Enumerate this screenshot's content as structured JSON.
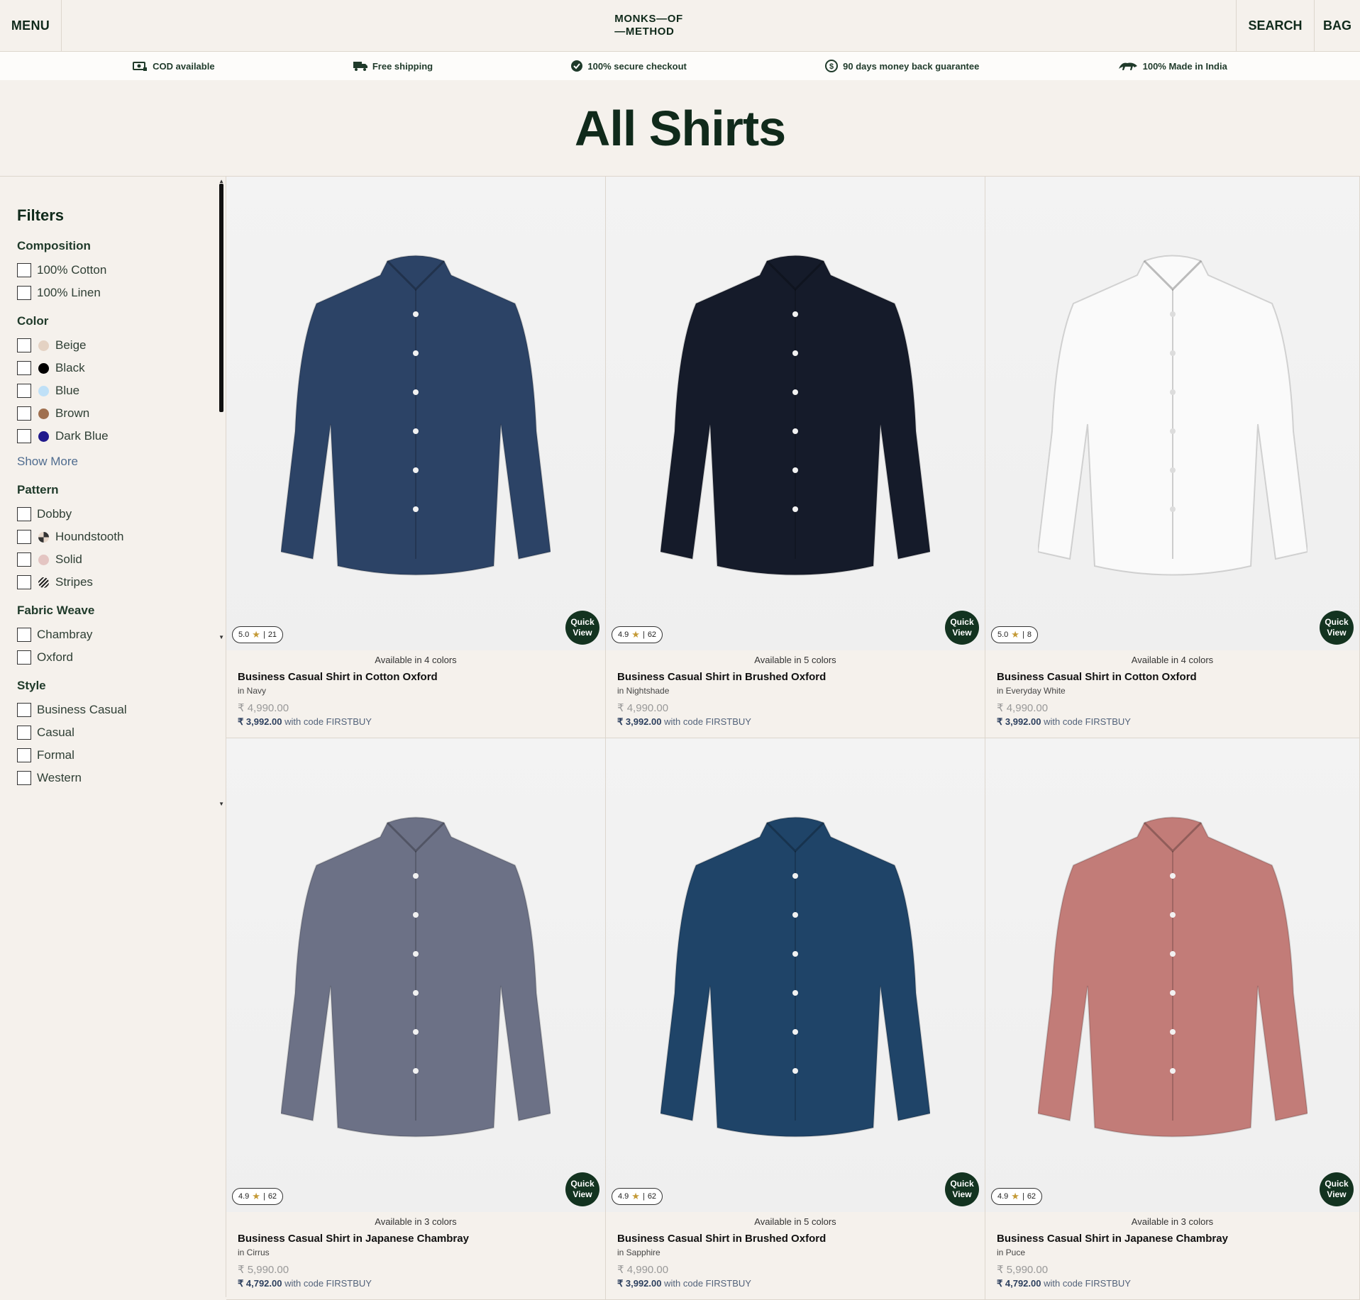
{
  "header": {
    "menu_label": "MENU",
    "logo_line1": "MONKS—OF",
    "logo_line2": "—METHOD",
    "search_label": "SEARCH",
    "bag_label": "BAG"
  },
  "usp": [
    {
      "icon": "cod-icon",
      "text": "COD available"
    },
    {
      "icon": "truck-icon",
      "text": "Free shipping"
    },
    {
      "icon": "check-badge-icon",
      "text": "100% secure checkout"
    },
    {
      "icon": "money-back-icon",
      "text": "90 days money back guarantee"
    },
    {
      "icon": "lion-icon",
      "text": "100% Made in India"
    }
  ],
  "page_title": "All Shirts",
  "filters": {
    "title": "Filters",
    "groups": [
      {
        "title": "Composition",
        "options": [
          {
            "label": "100% Cotton"
          },
          {
            "label": "100% Linen"
          }
        ]
      },
      {
        "title": "Color",
        "options": [
          {
            "label": "Beige",
            "swatch": "#e4d2c3"
          },
          {
            "label": "Black",
            "swatch": "#000000"
          },
          {
            "label": "Blue",
            "swatch": "#bfe0f7"
          },
          {
            "label": "Brown",
            "swatch": "#a0704f"
          },
          {
            "label": "Dark Blue",
            "swatch": "#211a8c"
          }
        ],
        "show_more": "Show More"
      },
      {
        "title": "Pattern",
        "options": [
          {
            "label": "Dobby"
          },
          {
            "label": "Houndstooth",
            "swatch": "houndstooth"
          },
          {
            "label": "Solid",
            "swatch": "#e4c5c2"
          },
          {
            "label": "Stripes",
            "swatch": "stripes"
          }
        ]
      },
      {
        "title": "Fabric Weave",
        "options": [
          {
            "label": "Chambray"
          },
          {
            "label": "Oxford"
          }
        ]
      },
      {
        "title": "Style",
        "options": [
          {
            "label": "Business Casual"
          },
          {
            "label": "Casual"
          },
          {
            "label": "Formal"
          },
          {
            "label": "Western"
          }
        ]
      }
    ]
  },
  "products": [
    {
      "rating": "5.0",
      "reviews": "21",
      "available": "Available in 4 colors",
      "name": "Business Casual Shirt in Cotton Oxford",
      "color_name": "in Navy",
      "price": "₹ 4,990.00",
      "offer_price": "₹ 3,992.00",
      "offer_text": "with code FIRSTBUY",
      "quick_view_1": "Quick",
      "quick_view_2": "View",
      "shirt_color": "#2c4366",
      "shirt_icon": "shirt-navy-icon"
    },
    {
      "rating": "4.9",
      "reviews": "62",
      "available": "Available in 5 colors",
      "name": "Business Casual Shirt in Brushed Oxford",
      "color_name": "in Nightshade",
      "price": "₹ 4,990.00",
      "offer_price": "₹ 3,992.00",
      "offer_text": "with code FIRSTBUY",
      "quick_view_1": "Quick",
      "quick_view_2": "View",
      "shirt_color": "#151b2a",
      "shirt_icon": "shirt-nightshade-icon"
    },
    {
      "rating": "5.0",
      "reviews": "8",
      "available": "Available in 4 colors",
      "name": "Business Casual Shirt in Cotton Oxford",
      "color_name": "in Everyday White",
      "price": "₹ 4,990.00",
      "offer_price": "₹ 3,992.00",
      "offer_text": "with code FIRSTBUY",
      "quick_view_1": "Quick",
      "quick_view_2": "View",
      "shirt_color": "#fafafa",
      "shirt_icon": "shirt-white-icon"
    },
    {
      "rating": "4.9",
      "reviews": "62",
      "available": "Available in 3 colors",
      "name": "Business Casual Shirt in Japanese Chambray",
      "color_name": "in Cirrus",
      "price": "₹ 5,990.00",
      "offer_price": "₹ 4,792.00",
      "offer_text": "with code FIRSTBUY",
      "quick_view_1": "Quick",
      "quick_view_2": "View",
      "shirt_color": "#6c7186",
      "shirt_icon": "shirt-cirrus-icon"
    },
    {
      "rating": "4.9",
      "reviews": "62",
      "available": "Available in 5 colors",
      "name": "Business Casual Shirt in Brushed Oxford",
      "color_name": "in Sapphire",
      "price": "₹ 4,990.00",
      "offer_price": "₹ 3,992.00",
      "offer_text": "with code FIRSTBUY",
      "quick_view_1": "Quick",
      "quick_view_2": "View",
      "shirt_color": "#1f4468",
      "shirt_icon": "shirt-sapphire-icon"
    },
    {
      "rating": "4.9",
      "reviews": "62",
      "available": "Available in 3 colors",
      "name": "Business Casual Shirt in Japanese Chambray",
      "color_name": "in Puce",
      "price": "₹ 5,990.00",
      "offer_price": "₹ 4,792.00",
      "offer_text": "with code FIRSTBUY",
      "quick_view_1": "Quick",
      "quick_view_2": "View",
      "shirt_color": "#c27c78",
      "shirt_icon": "shirt-puce-icon"
    }
  ]
}
